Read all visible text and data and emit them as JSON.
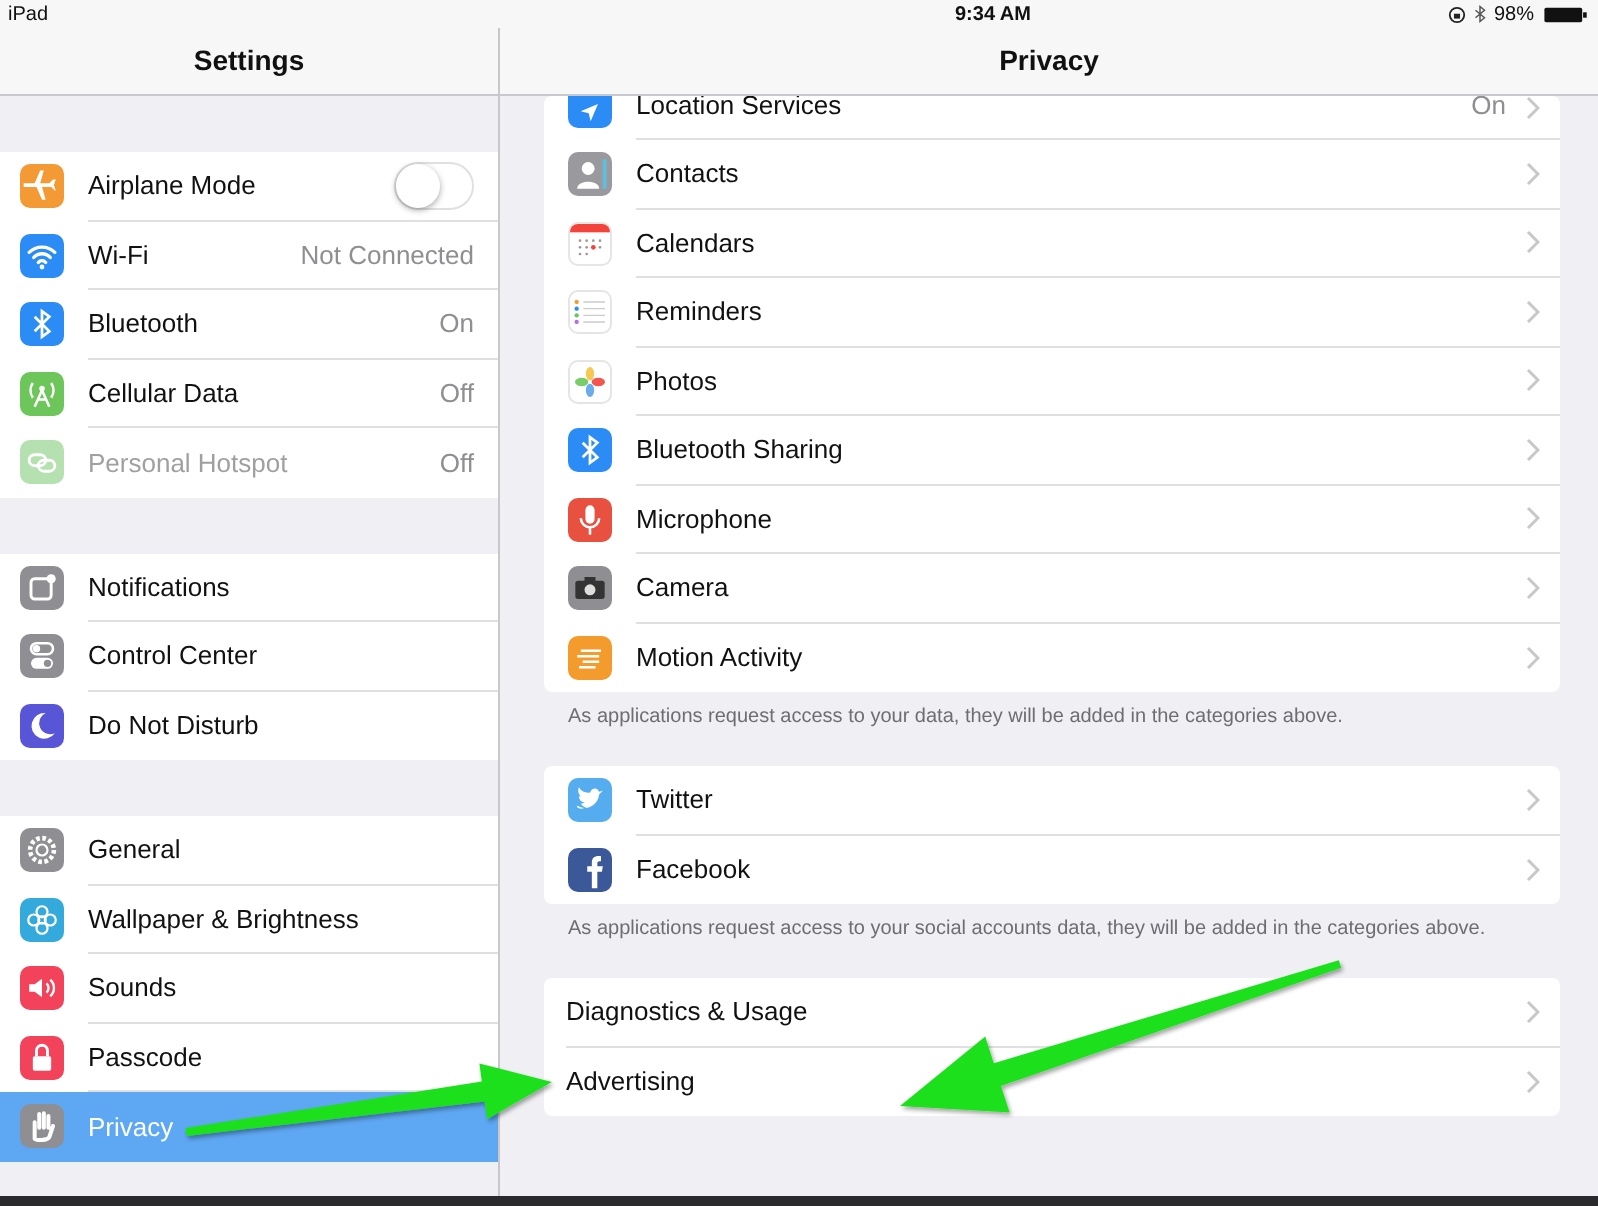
{
  "status_bar": {
    "device": "iPad",
    "time": "9:34 AM",
    "battery": "98%"
  },
  "sidebar": {
    "title": "Settings",
    "groups": [
      {
        "items": [
          {
            "label": "Airplane Mode",
            "kind": "toggle",
            "on": false,
            "disabled": false,
            "selected": false
          },
          {
            "label": "Wi-Fi",
            "value": "Not Connected",
            "kind": "link",
            "disabled": false,
            "selected": false
          },
          {
            "label": "Bluetooth",
            "value": "On",
            "kind": "link",
            "disabled": false,
            "selected": false
          },
          {
            "label": "Cellular Data",
            "value": "Off",
            "kind": "link",
            "disabled": false,
            "selected": false
          },
          {
            "label": "Personal Hotspot",
            "value": "Off",
            "kind": "link",
            "disabled": true,
            "selected": false
          }
        ]
      },
      {
        "items": [
          {
            "label": "Notifications",
            "kind": "link",
            "disabled": false,
            "selected": false
          },
          {
            "label": "Control Center",
            "kind": "link",
            "disabled": false,
            "selected": false
          },
          {
            "label": "Do Not Disturb",
            "kind": "link",
            "disabled": false,
            "selected": false
          }
        ]
      },
      {
        "items": [
          {
            "label": "General",
            "kind": "link",
            "disabled": false,
            "selected": false
          },
          {
            "label": "Wallpaper & Brightness",
            "kind": "link",
            "disabled": false,
            "selected": false
          },
          {
            "label": "Sounds",
            "kind": "link",
            "disabled": false,
            "selected": false
          },
          {
            "label": "Passcode",
            "kind": "link",
            "disabled": false,
            "selected": false
          },
          {
            "label": "Privacy",
            "kind": "link",
            "disabled": false,
            "selected": true
          }
        ]
      }
    ]
  },
  "detail": {
    "title": "Privacy",
    "sections": [
      {
        "items": [
          {
            "label": "Location Services",
            "value": "On"
          },
          {
            "label": "Contacts"
          },
          {
            "label": "Calendars"
          },
          {
            "label": "Reminders"
          },
          {
            "label": "Photos"
          },
          {
            "label": "Bluetooth Sharing"
          },
          {
            "label": "Microphone"
          },
          {
            "label": "Camera"
          },
          {
            "label": "Motion Activity"
          }
        ],
        "footer": "As applications request access to your data, they will be added in the categories above."
      },
      {
        "items": [
          {
            "label": "Twitter"
          },
          {
            "label": "Facebook"
          }
        ],
        "footer": "As applications request access to your social accounts data, they will be added in the categories above."
      },
      {
        "items": [
          {
            "label": "Diagnostics & Usage"
          },
          {
            "label": "Advertising"
          }
        ]
      }
    ]
  }
}
